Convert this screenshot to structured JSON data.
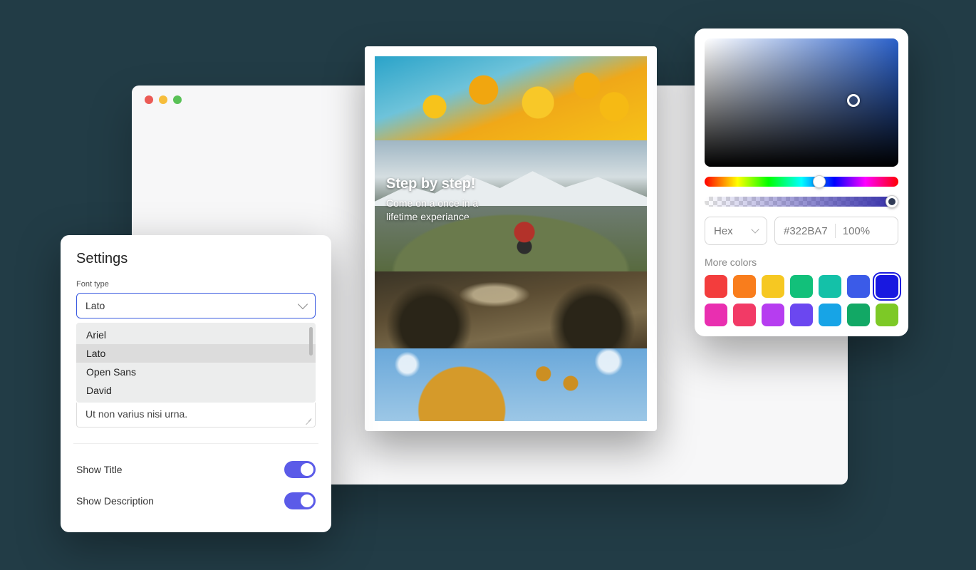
{
  "settings": {
    "title": "Settings",
    "font_label": "Font type",
    "font_selected": "Lato",
    "font_options": [
      "Ariel",
      "Lato",
      "Open Sans",
      "David"
    ],
    "textarea_value": "Ut non varius nisi urna.",
    "toggle_title": "Show Title",
    "toggle_desc": "Show Description"
  },
  "preview": {
    "headline": "Step by step!",
    "sub1": "Come on a once in a",
    "sub2": "lifetime experiance"
  },
  "picker": {
    "format": "Hex",
    "hex": "#322BA7",
    "opacity": "100%",
    "more_label": "More colors",
    "swatches": [
      {
        "c": "#f33d3d"
      },
      {
        "c": "#f97d1c"
      },
      {
        "c": "#f6c822"
      },
      {
        "c": "#12c07a"
      },
      {
        "c": "#14c1a8"
      },
      {
        "c": "#3b5be8"
      },
      {
        "c": "#1818e0",
        "sel": true
      },
      {
        "c": "#e92fb0"
      },
      {
        "c": "#f23a66"
      },
      {
        "c": "#b63df0"
      },
      {
        "c": "#6b47f0"
      },
      {
        "c": "#17a4e6"
      },
      {
        "c": "#12a865"
      },
      {
        "c": "#7dc926"
      }
    ]
  }
}
